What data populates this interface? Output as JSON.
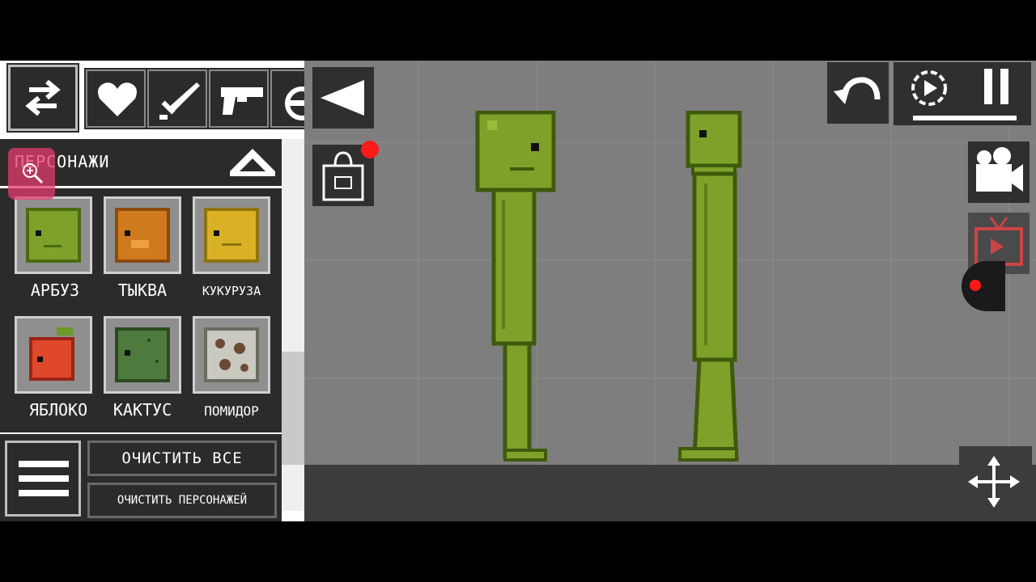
{
  "category": {
    "title": "ПЕРСОНАЖИ"
  },
  "items": [
    {
      "label": "АРБУЗ",
      "color": "#7fa12a",
      "dark": "#4d6b10"
    },
    {
      "label": "ТЫКВА",
      "color": "#d07a1e",
      "dark": "#8c4a0c"
    },
    {
      "label": "КУКУРУЗА",
      "color": "#d8b224",
      "dark": "#8f7410"
    },
    {
      "label": "ЯБЛОКО",
      "color": "#e0482b",
      "dark": "#9c2414"
    },
    {
      "label": "КАКТУС",
      "color": "#4f7a3e",
      "dark": "#2b4a1f"
    },
    {
      "label": "ПОМИДОР",
      "color": "#c9c9c0",
      "dark": "#6b4a36"
    }
  ],
  "actions": {
    "clear_all": "ОЧИСТИТЬ ВСЕ",
    "clear_characters": "ОЧИСТИТЬ ПЕРСОНАЖЕЙ"
  },
  "icons": {
    "swap": "swap-arrows-icon",
    "tabs": [
      "heart-icon",
      "sword-icon",
      "pistol-icon",
      "bomb-icon"
    ],
    "back": "triangle-left-icon",
    "shop": "shopping-bag-icon",
    "undo": "undo-icon",
    "slow_motion": "slow-motion-icon",
    "pause": "pause-icon",
    "camera": "video-camera-icon",
    "tv": "tv-icon",
    "move": "move-arrows-icon"
  },
  "colors": {
    "melon": "#7fa12a",
    "melon_dark": "#3e5a0c",
    "panel": "#2b2b2b",
    "notification": "#ff1a1a"
  }
}
